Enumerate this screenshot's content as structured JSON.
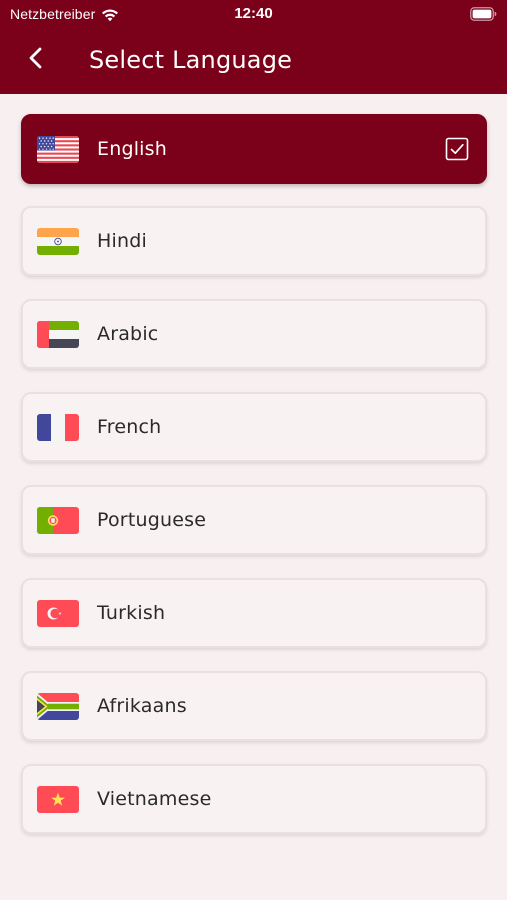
{
  "status_bar": {
    "carrier": "Netzbetreiber",
    "time": "12:40",
    "icons": [
      "wifi-icon",
      "battery-icon"
    ]
  },
  "header": {
    "title": "Select Language",
    "back_icon": "chevron-left-icon"
  },
  "colors": {
    "brand": "#7b0019",
    "background": "#f7eff0",
    "card_border": "#e8e0e1",
    "text": "#2a2a2a"
  },
  "languages": [
    {
      "label": "English",
      "flag": "us-flag-icon",
      "selected": true
    },
    {
      "label": "Hindi",
      "flag": "india-flag-icon",
      "selected": false
    },
    {
      "label": "Arabic",
      "flag": "uae-flag-icon",
      "selected": false
    },
    {
      "label": "French",
      "flag": "france-flag-icon",
      "selected": false
    },
    {
      "label": "Portuguese",
      "flag": "portugal-flag-icon",
      "selected": false
    },
    {
      "label": "Turkish",
      "flag": "turkey-flag-icon",
      "selected": false
    },
    {
      "label": "Afrikaans",
      "flag": "south-africa-flag-icon",
      "selected": false
    },
    {
      "label": "Vietnamese",
      "flag": "vietnam-flag-icon",
      "selected": false
    }
  ]
}
